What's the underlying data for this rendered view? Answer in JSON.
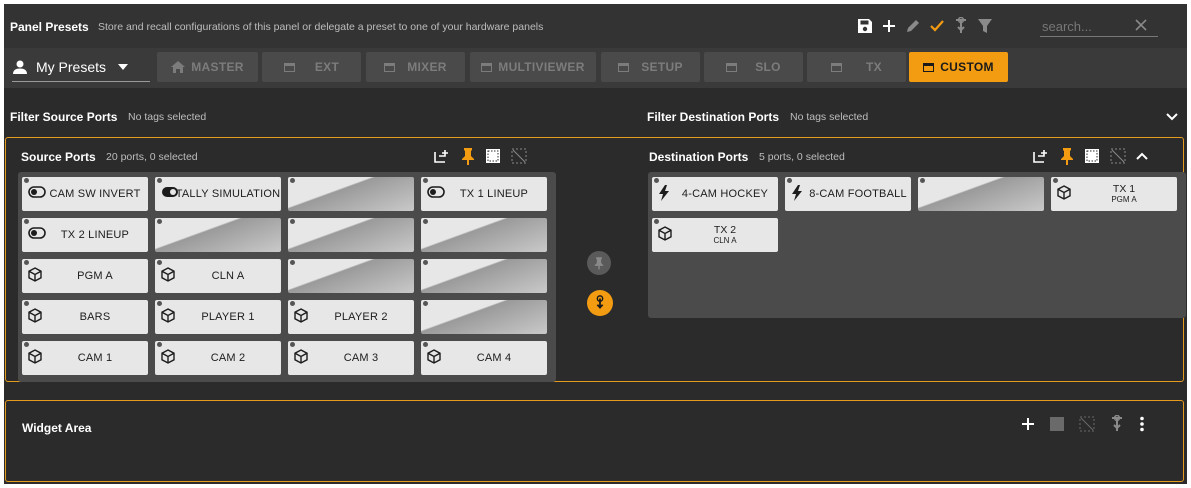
{
  "panel_presets": {
    "title": "Panel Presets",
    "description": "Store and recall configurations of this panel or delegate a preset to one of your hardware panels",
    "search_placeholder": "search..."
  },
  "presets": {
    "selector_label": "My Presets",
    "buttons": [
      {
        "label": "MASTER",
        "icon": "home-icon",
        "active": false
      },
      {
        "label": "EXT",
        "icon": "window-icon",
        "active": false
      },
      {
        "label": "MIXER",
        "icon": "window-icon",
        "active": false
      },
      {
        "label": "MULTIVIEWER",
        "icon": "window-icon",
        "active": false
      },
      {
        "label": "SETUP",
        "icon": "window-icon",
        "active": false
      },
      {
        "label": "SLO",
        "icon": "window-icon",
        "active": false
      },
      {
        "label": "TX",
        "icon": "window-icon",
        "active": false
      },
      {
        "label": "CUSTOM",
        "icon": "window-icon",
        "active": true
      }
    ]
  },
  "filters": {
    "source_label": "Filter Source Ports",
    "source_value": "No tags selected",
    "dest_label": "Filter Destination Ports",
    "dest_value": "No tags selected"
  },
  "source_ports": {
    "title": "Source Ports",
    "summary": "20 ports, 0 selected",
    "ports": [
      {
        "label": "CAM SW INVERT",
        "icon": "toggle-off-icon"
      },
      {
        "label": "TALLY SIMULATION",
        "icon": "toggle-on-icon"
      },
      {
        "label": "",
        "icon": ""
      },
      {
        "label": "TX 1 LINEUP",
        "icon": "toggle-off-icon"
      },
      {
        "label": "TX 2 LINEUP",
        "icon": "toggle-off-icon"
      },
      {
        "label": "",
        "icon": ""
      },
      {
        "label": "",
        "icon": ""
      },
      {
        "label": "",
        "icon": ""
      },
      {
        "label": "PGM A",
        "icon": "cube-icon"
      },
      {
        "label": "CLN A",
        "icon": "cube-icon"
      },
      {
        "label": "",
        "icon": ""
      },
      {
        "label": "",
        "icon": ""
      },
      {
        "label": "BARS",
        "icon": "cube-icon"
      },
      {
        "label": "PLAYER 1",
        "icon": "cube-icon"
      },
      {
        "label": "PLAYER 2",
        "icon": "cube-icon"
      },
      {
        "label": "",
        "icon": ""
      },
      {
        "label": "CAM 1",
        "icon": "cube-icon"
      },
      {
        "label": "CAM 2",
        "icon": "cube-icon"
      },
      {
        "label": "CAM 3",
        "icon": "cube-icon"
      },
      {
        "label": "CAM 4",
        "icon": "cube-icon"
      }
    ]
  },
  "destination_ports": {
    "title": "Destination Ports",
    "summary": "5 ports, 0 selected",
    "ports": [
      {
        "label": "4-CAM HOCKEY",
        "sub": "",
        "icon": "bolt-icon"
      },
      {
        "label": "8-CAM FOOTBALL",
        "sub": "",
        "icon": "bolt-icon"
      },
      {
        "label": "",
        "sub": "",
        "icon": ""
      },
      {
        "label": "TX 1",
        "sub": "PGM A",
        "icon": "cube-icon"
      },
      {
        "label": "TX 2",
        "sub": "CLN A",
        "icon": "cube-icon"
      }
    ]
  },
  "widget_area": {
    "title": "Widget Area"
  },
  "colors": {
    "accent": "#f39c12",
    "panel_bg": "#2b2b2b",
    "port_bg": "#e7e7e7"
  }
}
